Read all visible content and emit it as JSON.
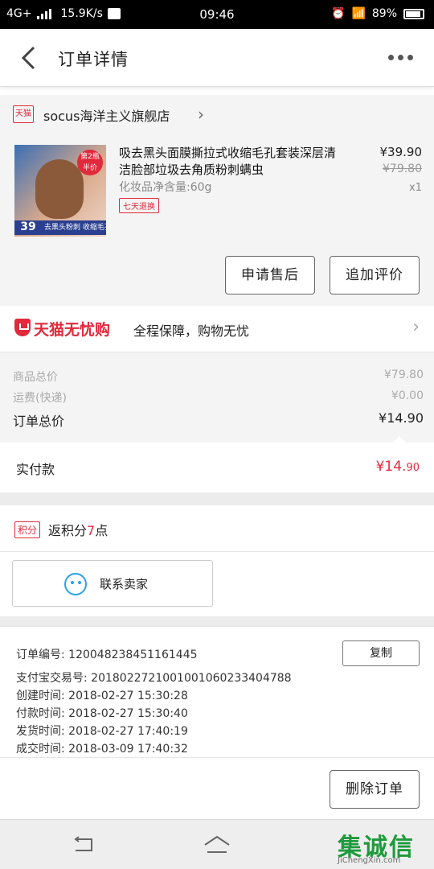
{
  "status_bar": {
    "network": "4G+",
    "speed": "15.9K/s",
    "time": "09:46",
    "battery": "89%"
  },
  "header": {
    "title": "订单详情"
  },
  "store": {
    "badge": "天猫",
    "name": "socus海洋主义旗舰店"
  },
  "product": {
    "title": "吸去黑头面膜撕拉式收缩毛孔套装深层清洁脸部垃圾去角质粉刺螨虫",
    "spec": "化妆品净含量:60g",
    "tag": "七天退换",
    "price": "¥39.90",
    "original_price": "¥79.80",
    "quantity": "x1",
    "thumb_badge": "第2瓶半价",
    "thumb_price": "39",
    "thumb_caption": "去黑头粉刺 收缩毛孔"
  },
  "actions": {
    "after_sale": "申请售后",
    "add_review": "追加评价"
  },
  "guarantee": {
    "brand": "天猫无忧购",
    "text": "全程保障，购物无忧"
  },
  "summary": {
    "goods_total_label": "商品总价",
    "goods_total_value": "¥79.80",
    "shipping_label": "运费(快递)",
    "shipping_value": "¥0.00",
    "order_total_label": "订单总价",
    "order_total_value": "¥14.90"
  },
  "paid": {
    "label": "实付款",
    "amount_main": "¥14.",
    "amount_cents": "90"
  },
  "points": {
    "badge": "积分",
    "text_prefix": "返积分",
    "count": "7",
    "text_suffix": "点"
  },
  "contact": {
    "label": "联系卖家"
  },
  "order_info": {
    "order_no_label": "订单编号:",
    "order_no": "120048238451161445",
    "copy_label": "复制",
    "alipay_label": "支付宝交易号:",
    "alipay_no": "2018022721001001060233404788",
    "created_label": "创建时间:",
    "created": "2018-02-27 15:30:28",
    "paid_label": "付款时间:",
    "paid": "2018-02-27 15:30:40",
    "shipped_label": "发货时间:",
    "shipped": "2018-02-27 17:40:19",
    "completed_label": "成交时间:",
    "completed": "2018-03-09 17:40:32"
  },
  "footer": {
    "delete_order": "删除订单"
  },
  "watermark": {
    "text": "集诚信",
    "sub": "JiChengXin.com"
  }
}
